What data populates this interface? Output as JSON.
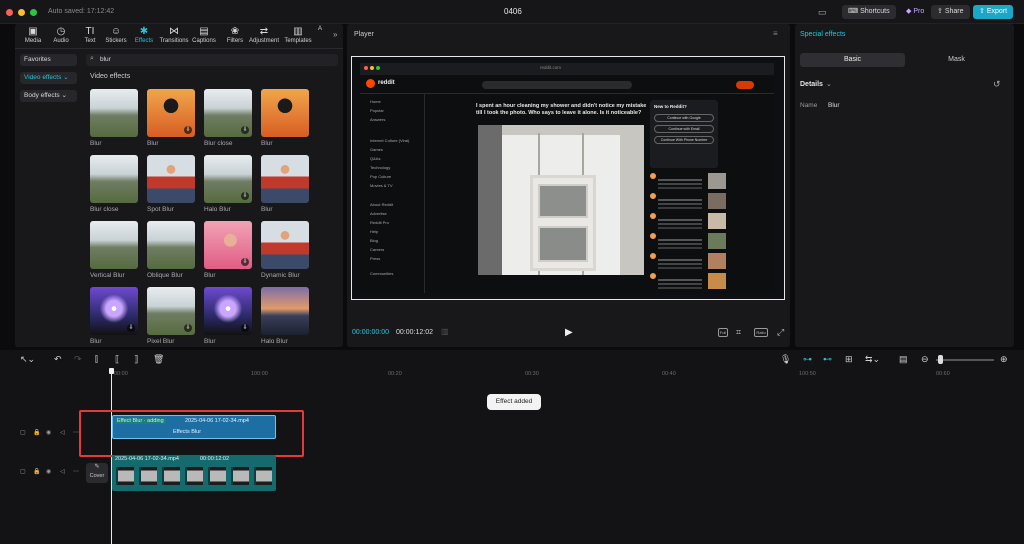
{
  "window": {
    "autosave": "Auto saved: 17:12:42",
    "title": "0406",
    "shortcuts": "Shortcuts",
    "pro": "Pro",
    "share": "Share",
    "export": "Export"
  },
  "toolbar_tabs": [
    {
      "label": "Media",
      "icon": "media-icon",
      "glyph": "▣"
    },
    {
      "label": "Audio",
      "icon": "audio-icon",
      "glyph": "◷"
    },
    {
      "label": "Text",
      "icon": "text-icon",
      "glyph": "TI"
    },
    {
      "label": "Stickers",
      "icon": "stickers-icon",
      "glyph": "☺"
    },
    {
      "label": "Effects",
      "icon": "effects-icon",
      "glyph": "✱"
    },
    {
      "label": "Transitions",
      "icon": "transitions-icon",
      "glyph": "⋈"
    },
    {
      "label": "Captions",
      "icon": "captions-icon",
      "glyph": "▤"
    },
    {
      "label": "Filters",
      "icon": "filters-icon",
      "glyph": "❀"
    },
    {
      "label": "Adjustment",
      "icon": "adjustment-icon",
      "glyph": "⇄"
    },
    {
      "label": "Templates",
      "icon": "templates-icon",
      "glyph": "▥"
    },
    {
      "label": "A",
      "icon": "more-tab-icon",
      "glyph": ""
    }
  ],
  "sidebar": {
    "favorites": "Favorites",
    "video_effects": "Video effects",
    "body_effects": "Body effects"
  },
  "search": {
    "value": "blur"
  },
  "effects_section_title": "Video effects",
  "effects": [
    {
      "label": "Blur",
      "kind": "field",
      "download": false
    },
    {
      "label": "Blur",
      "kind": "portrait",
      "download": true
    },
    {
      "label": "Blur close",
      "kind": "field",
      "download": true
    },
    {
      "label": "Blur",
      "kind": "portrait",
      "download": false
    },
    {
      "label": "Blur close",
      "kind": "field",
      "download": false
    },
    {
      "label": "Spot Blur",
      "kind": "person",
      "download": false
    },
    {
      "label": "Halo Blur",
      "kind": "field",
      "download": true
    },
    {
      "label": "Blur",
      "kind": "person",
      "download": false
    },
    {
      "label": "Vertical Blur",
      "kind": "field",
      "download": false
    },
    {
      "label": "Oblique Blur",
      "kind": "field",
      "download": false
    },
    {
      "label": "Blur",
      "kind": "pink",
      "download": true
    },
    {
      "label": "Dynamic Blur",
      "kind": "person",
      "download": false
    },
    {
      "label": "Blur",
      "kind": "purple",
      "download": true
    },
    {
      "label": "Pixel Blur",
      "kind": "field",
      "download": true
    },
    {
      "label": "Blur",
      "kind": "purple",
      "download": true
    },
    {
      "label": "Halo Blur",
      "kind": "city",
      "download": false
    }
  ],
  "player": {
    "title": "Player",
    "current_time": "00:00:00:00",
    "total_time": "00:00:12:02",
    "full": "Full",
    "ratio": "Ratio"
  },
  "reddit": {
    "url": "reddit.com",
    "logo": "reddit",
    "post_title": "I spent an hour cleaning my shower and didn't notice my mistake till I took the photo. Who says to leave it alone. Is it noticeable?",
    "sidebar_title": "New to Reddit?",
    "login_buttons": [
      "Continue with Google",
      "Continue with Email",
      "Continue With Phone Number"
    ],
    "nav": [
      "Home",
      "Popular",
      "Answers"
    ],
    "topics": [
      "Internet Culture (Viral)",
      "Games",
      "Q&As",
      "Technology",
      "Pop Culture",
      "Movies & TV"
    ],
    "resources": [
      "About Reddit",
      "Advertise",
      "Reddit Pro",
      "Help",
      "Blog",
      "Careers",
      "Press"
    ],
    "communities": "Communities"
  },
  "inspector": {
    "title": "Special effects",
    "tab_basic": "Basic",
    "tab_mask": "Mask",
    "details": "Details",
    "name_key": "Name",
    "name_value": "Blur"
  },
  "timeline": {
    "ticks": [
      "00:00",
      "100:00",
      "00:20",
      "00:30",
      "00:40",
      "100:50",
      "00:60",
      "00:70",
      "100:80",
      "00:90",
      "100:10"
    ],
    "toast": "Effect added",
    "effect_clip": "Effect Blur · adding",
    "effect_file": "2025-04-06 17-02-34.mp4",
    "effect_inner": "Effects Blur",
    "video_clip": "2025-04-06 17-02-34.mp4",
    "video_duration": "00:00:12:02",
    "cover": "Cover"
  },
  "colors": {
    "accent": "#22c7d8",
    "export": "#1aa7c8",
    "highlight": "#e23b3b"
  }
}
